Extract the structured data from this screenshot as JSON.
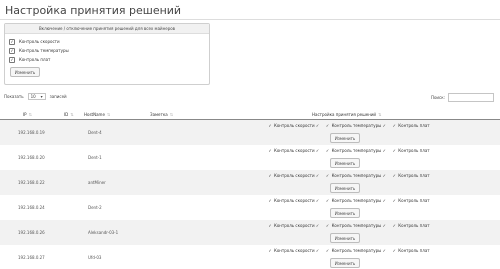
{
  "page": {
    "title": "Настройка принятия решений"
  },
  "panel": {
    "header": "Включение / отключение принятия решений для всех майнеров",
    "options": [
      {
        "label": "Контроль скорости",
        "checked": true
      },
      {
        "label": "Контроль температуры",
        "checked": true
      },
      {
        "label": "Контроль плат",
        "checked": true
      }
    ],
    "apply_label": "Изменить"
  },
  "controls": {
    "show_label": "Показать",
    "page_size": "10",
    "records_label": "записей",
    "search_label": "Поиск:"
  },
  "table": {
    "columns": {
      "ip": "IP",
      "id": "ID",
      "hostname": "HostName",
      "note": "Заметка",
      "settings": "Настройка принятия решений"
    },
    "control_labels": {
      "speed": "Контроль скорости",
      "temperature": "Контроль температуры",
      "boards": "Контроль плат"
    },
    "row_button": "Изменить",
    "rows": [
      {
        "ip": "192.168.0.19",
        "hostname": "Dent-4",
        "speed": true,
        "temp": true,
        "boards": true,
        "style": "odd"
      },
      {
        "ip": "192.168.0.20",
        "hostname": "Dent-1",
        "speed": true,
        "temp": true,
        "boards": true,
        "style": "even"
      },
      {
        "ip": "192.168.0.22",
        "hostname": "antMiner",
        "speed": true,
        "temp": true,
        "boards": true,
        "style": "odd"
      },
      {
        "ip": "192.168.0.24",
        "hostname": "Dent-2",
        "speed": true,
        "temp": true,
        "boards": true,
        "style": "even"
      },
      {
        "ip": "192.168.0.26",
        "hostname": "Aleksandr-03-1",
        "speed": true,
        "temp": true,
        "boards": true,
        "style": "odd"
      },
      {
        "ip": "192.168.0.27",
        "hostname": "Ufd-03",
        "speed": true,
        "temp": true,
        "boards": true,
        "style": "even"
      }
    ]
  }
}
